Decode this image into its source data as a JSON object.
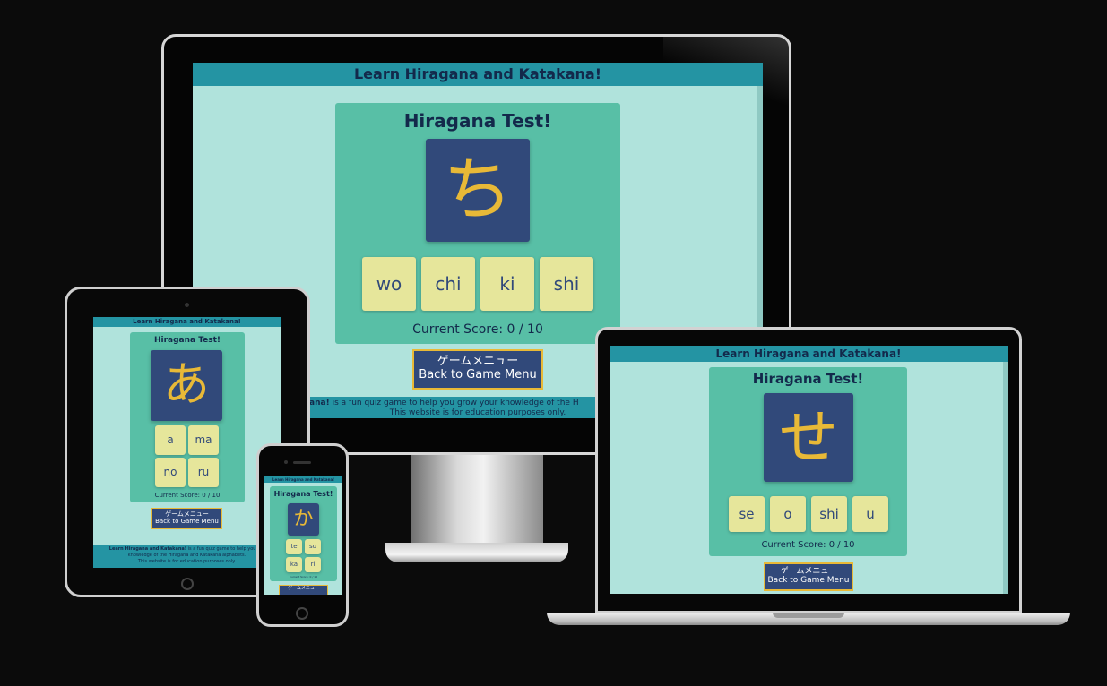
{
  "site": {
    "header_title": "Learn Hiragana and Katakana!",
    "footer_line1_bold": "Learn Hiragana and Katakana!",
    "footer_line1_bold_visible_desktop": "! Katakana!",
    "footer_line1_rest": "is a fun quiz game to help you grow your knowledge of the Hiragana and Katakana alphabets.",
    "footer_line1_rest_visible_desktop": "is a fun quiz game to help you grow your knowledge of the H",
    "footer_line1_rest_visible_tablet": "is a fun quiz game to help you gro",
    "footer_line2": "knowledge of the Hiragana and Katakana alphabets.",
    "footer_line3": "This website is for education purposes only.",
    "menu_jp": "ゲームメニュー",
    "menu_en": "Back to Game Menu"
  },
  "desktop": {
    "quiz_title": "Hiragana Test!",
    "kana": "ち",
    "answers": [
      "wo",
      "chi",
      "ki",
      "shi"
    ],
    "score": "Current Score: 0 / 10"
  },
  "tablet": {
    "quiz_title": "Hiragana Test!",
    "kana": "あ",
    "answers": [
      "a",
      "ma",
      "no",
      "ru"
    ],
    "score": "Current Score: 0 / 10"
  },
  "phone": {
    "quiz_title": "Hiragana Test!",
    "kana": "か",
    "answers": [
      "te",
      "su",
      "ka",
      "ri"
    ],
    "score": "Current Score: 0 / 10"
  },
  "laptop": {
    "quiz_title": "Hiragana Test!",
    "kana": "せ",
    "answers": [
      "se",
      "o",
      "shi",
      "u"
    ],
    "score": "Current Score: 0 / 10"
  },
  "colors": {
    "background": "#0b0b0b",
    "header": "#2494a3",
    "page": "#b0e3dc",
    "card": "#58bfa6",
    "kana_box": "#31497a",
    "kana_text": "#e8b937",
    "answer_button": "#e6e69b"
  }
}
